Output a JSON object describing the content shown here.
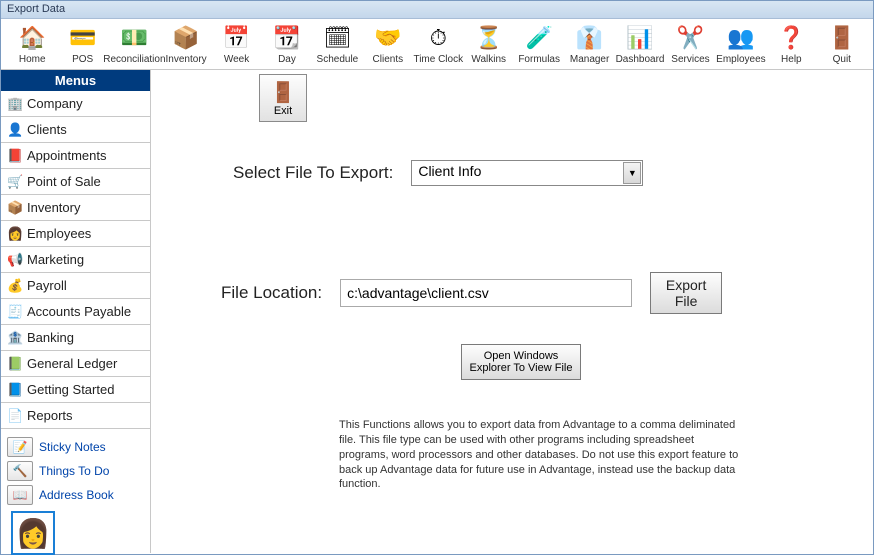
{
  "window": {
    "title": "Export Data"
  },
  "toolbar": [
    {
      "label": "Home",
      "icon": "🏠"
    },
    {
      "label": "POS",
      "icon": "💳"
    },
    {
      "label": "Reconciliation",
      "icon": "💵"
    },
    {
      "label": "Inventory",
      "icon": "📦"
    },
    {
      "label": "Week",
      "icon": "📅"
    },
    {
      "label": "Day",
      "icon": "📆"
    },
    {
      "label": "Schedule",
      "icon": "🗓"
    },
    {
      "label": "Clients",
      "icon": "🤝"
    },
    {
      "label": "Time Clock",
      "icon": "⏱"
    },
    {
      "label": "Walkins",
      "icon": "⏳"
    },
    {
      "label": "Formulas",
      "icon": "🧪"
    },
    {
      "label": "Manager",
      "icon": "👔"
    },
    {
      "label": "Dashboard",
      "icon": "📊"
    },
    {
      "label": "Services",
      "icon": "✂️"
    },
    {
      "label": "Employees",
      "icon": "👥"
    },
    {
      "label": "Help",
      "icon": "❓"
    },
    {
      "label": "Quit",
      "icon": "🚪"
    }
  ],
  "sidebar": {
    "header": "Menus",
    "items": [
      {
        "label": "Company",
        "icon": "🏢"
      },
      {
        "label": "Clients",
        "icon": "👤"
      },
      {
        "label": "Appointments",
        "icon": "📕"
      },
      {
        "label": "Point of Sale",
        "icon": "🛒"
      },
      {
        "label": "Inventory",
        "icon": "📦"
      },
      {
        "label": "Employees",
        "icon": "👩"
      },
      {
        "label": "Marketing",
        "icon": "📢"
      },
      {
        "label": "Payroll",
        "icon": "💰"
      },
      {
        "label": "Accounts Payable",
        "icon": "🧾"
      },
      {
        "label": "Banking",
        "icon": "🏦"
      },
      {
        "label": "General Ledger",
        "icon": "📗"
      },
      {
        "label": "Getting Started",
        "icon": "📘"
      },
      {
        "label": "Reports",
        "icon": "📄"
      }
    ],
    "shortcuts": [
      {
        "label": "Sticky Notes",
        "icon": "📝"
      },
      {
        "label": "Things To Do",
        "icon": "🔨"
      },
      {
        "label": "Address Book",
        "icon": "📖"
      }
    ]
  },
  "content": {
    "exit_label": "Exit",
    "select_label": "Select File To Export:",
    "select_value": "Client Info",
    "location_label": "File Location:",
    "location_value": "c:\\advantage\\client.csv",
    "export_button": "Export\nFile",
    "explorer_button": "Open Windows\nExplorer To View File",
    "info": "This Functions allows you to export data from Advantage to a comma deliminated file. This file type can be used with other programs including spreadsheet programs, word processors and other databases.  Do not use this export feature to back up Advantage data for future use in Advantage, instead use the backup data function."
  }
}
